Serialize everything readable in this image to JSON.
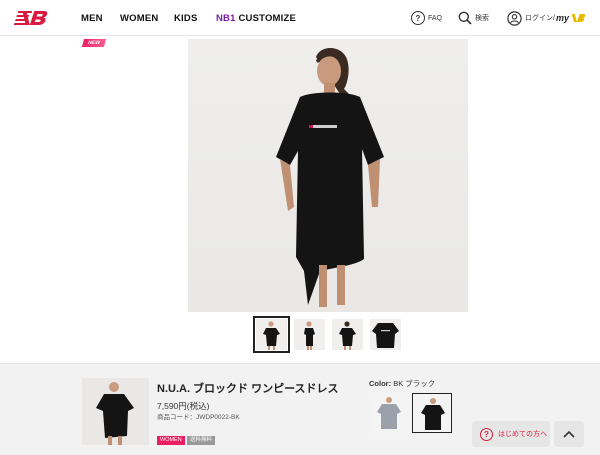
{
  "header": {
    "logo": "New Balance logo",
    "nav": [
      {
        "label": "MEN"
      },
      {
        "label": "WOMEN"
      },
      {
        "label": "KIDS"
      },
      {
        "label_prefix": "NB1",
        "label": "CUSTOMIZE"
      }
    ],
    "faq_label": "FAQ",
    "search_label": "検索",
    "login_label": "ログイン/",
    "mynb_label": "my",
    "colors": {
      "brand_red": "#d81b3f",
      "nb1_purple": "#7b1fa2"
    }
  },
  "gallery": {
    "badge": "NEW",
    "main_image": "woman wearing black oversized t-shirt dress",
    "thumbnails": [
      {
        "name": "front view",
        "active": true
      },
      {
        "name": "side view",
        "active": false
      },
      {
        "name": "back view",
        "active": false
      },
      {
        "name": "flat garment",
        "active": false
      }
    ]
  },
  "product_bar": {
    "name": "N.U.A. ブロックド ワンピースドレス",
    "price": "7,590円(税込)",
    "code": "商品コード：JWDP0022-BK",
    "tags": [
      "WOMEN",
      "送料無料"
    ],
    "color_label": "Color:",
    "color_value": "BK ブラック",
    "swatches": [
      {
        "name": "grey",
        "selected": false
      },
      {
        "name": "black",
        "selected": true
      }
    ],
    "help_label": "はじめての方へ",
    "help_icon": "?"
  }
}
